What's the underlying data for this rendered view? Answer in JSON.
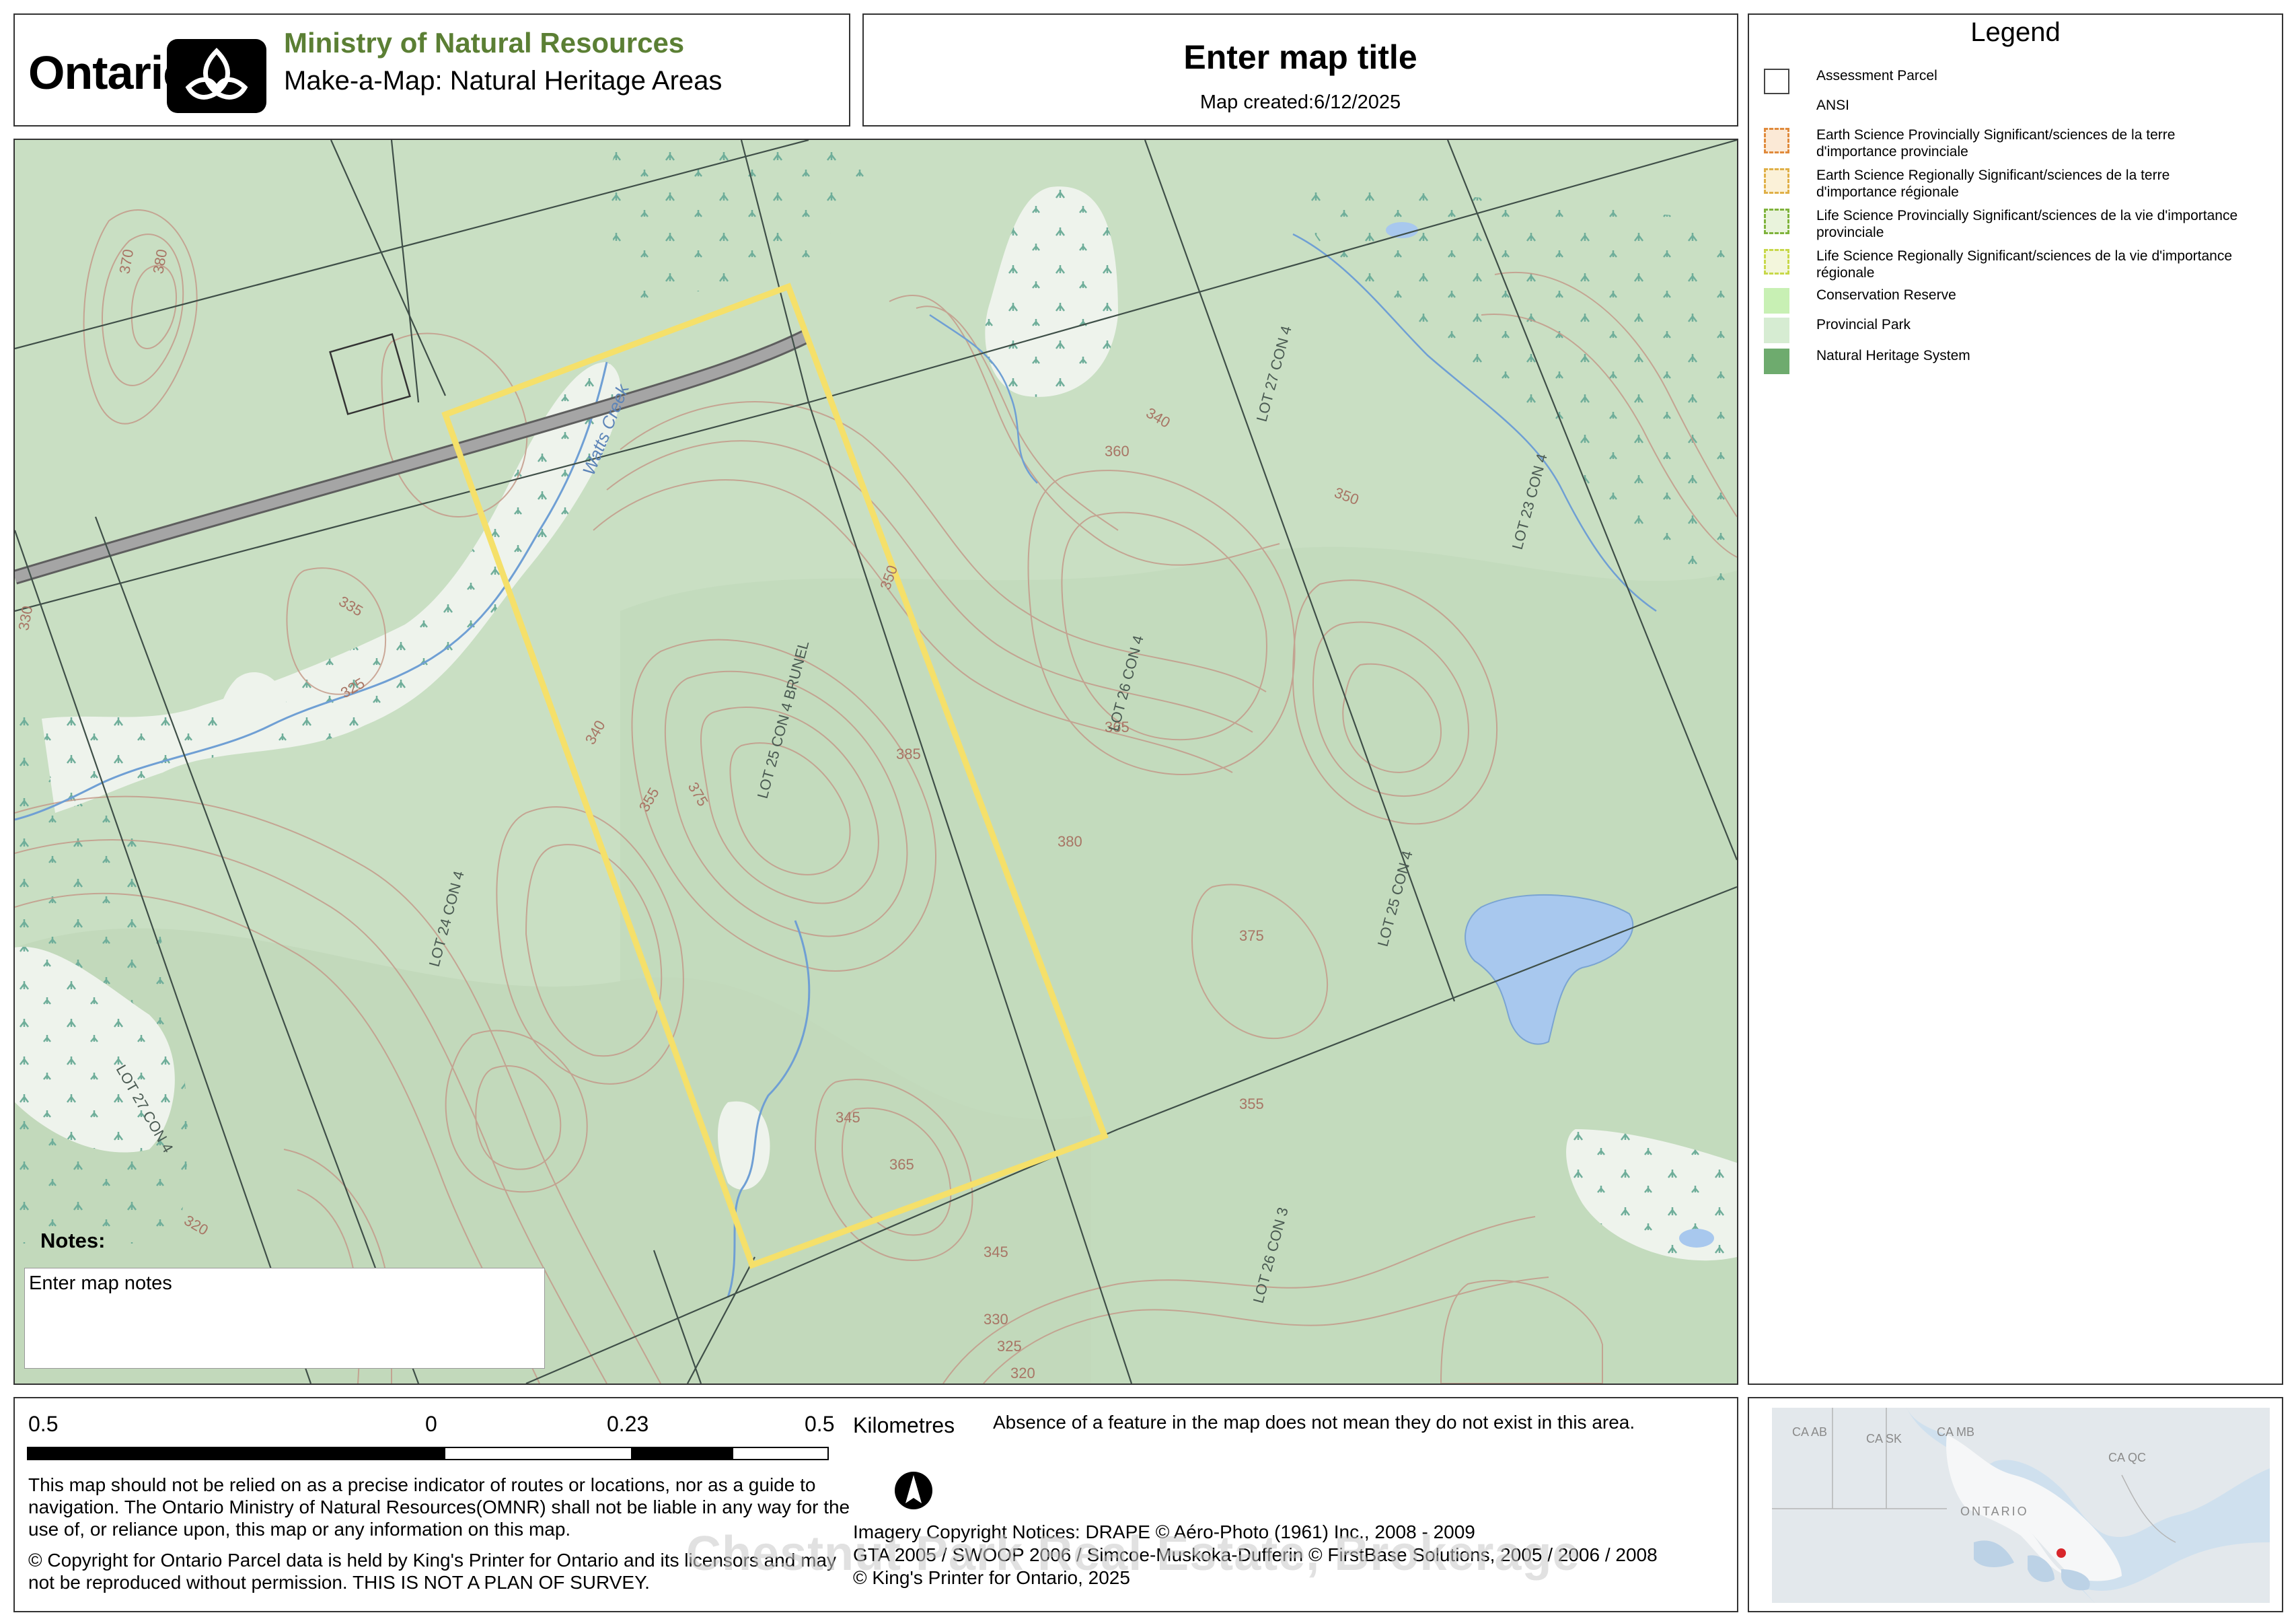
{
  "header": {
    "brand": "Ontario",
    "ministry": "Ministry of Natural Resources",
    "subtitle": "Make-a-Map: Natural Heritage Areas",
    "map_title": "Enter map title",
    "map_created": "Map created:6/12/2025"
  },
  "legend": {
    "title": "Legend",
    "items": [
      {
        "label": "Assessment Parcel",
        "symbol": "parcel-outline"
      },
      {
        "label": "ANSI",
        "symbol": "none"
      },
      {
        "label": "Earth Science Provincially Significant/sciences de la terre d'importance provinciale",
        "symbol": "earth-prov",
        "color": "#e08a3c"
      },
      {
        "label": "Earth Science Regionally Significant/sciences de la terre d'importance régionale",
        "symbol": "earth-reg",
        "color": "#e0b048"
      },
      {
        "label": "Life Science Provincially Significant/sciences de la vie d'importance provinciale",
        "symbol": "life-prov",
        "color": "#7fb33c"
      },
      {
        "label": "Life Science Regionally Significant/sciences de la vie d'importance régionale",
        "symbol": "life-reg",
        "color": "#c8d84a"
      },
      {
        "label": "Conservation Reserve",
        "color": "#c8f0b4"
      },
      {
        "label": "Provincial Park",
        "color": "#d6ecd2"
      },
      {
        "label": "Natural Heritage System",
        "color": "#6eab6e"
      }
    ]
  },
  "map": {
    "creek_label": "Watts Creek",
    "colors": {
      "base": "#c9dfc3",
      "wetland": "#eef3ec",
      "water": "#a8c8ee",
      "contour": "#c49a8a",
      "highlight": "#f5e06a",
      "road": "#9a9a9a"
    },
    "lot_labels": [
      "LOT 25 CON 4 BRUNEL",
      "LOT 26 CON 4",
      "LOT 24 CON 4",
      "LOT 27 CON 4",
      "LOT 23 CON 4",
      "LOT 25 CON 4",
      "LOT 26 CON 3",
      "LOT 27 CON 4"
    ],
    "contour_labels": [
      "370",
      "380",
      "335",
      "330",
      "325",
      "320",
      "340",
      "345",
      "350",
      "355",
      "360",
      "365",
      "375",
      "385",
      "340",
      "345",
      "365",
      "380",
      "375",
      "355",
      "350",
      "330",
      "325",
      "320"
    ]
  },
  "notes": {
    "label": "Notes:",
    "text": "Enter map notes"
  },
  "scale": {
    "labels": [
      "0.5",
      "0",
      "0.23",
      "0.5"
    ],
    "units": "Kilometres"
  },
  "footer": {
    "absence": "Absence of a feature in the map does not mean they do not exist in this area.",
    "disclaimer": "This map should not be relied on as a precise indicator of routes or locations, nor as a guide to navigation. The Ontario Ministry of Natural Resources(OMNR) shall not be liable in any way for the use of, or reliance upon, this map or any information on this map.",
    "copyright_parcel": "© Copyright for Ontario Parcel data is held by King's Printer for Ontario and its licensors and may not be reproduced without permission. THIS IS NOT A PLAN OF SURVEY.",
    "imagery": [
      "Imagery Copyright Notices: DRAPE © Aéro-Photo (1961) Inc., 2008 - 2009",
      "GTA 2005 / SWOOP 2006 / Simcoe-Muskoka-Dufferin © FirstBase Solutions, 2005 / 2006 / 2008",
      "© King's Printer for Ontario,  2025"
    ],
    "watermark": "Chestnut Park Real Estate, Brokerage"
  },
  "inset": {
    "labels": [
      "CA AB",
      "CA SK",
      "CA MB",
      "CA QC",
      "ONTARIO"
    ],
    "marker_color": "#d8262b"
  }
}
